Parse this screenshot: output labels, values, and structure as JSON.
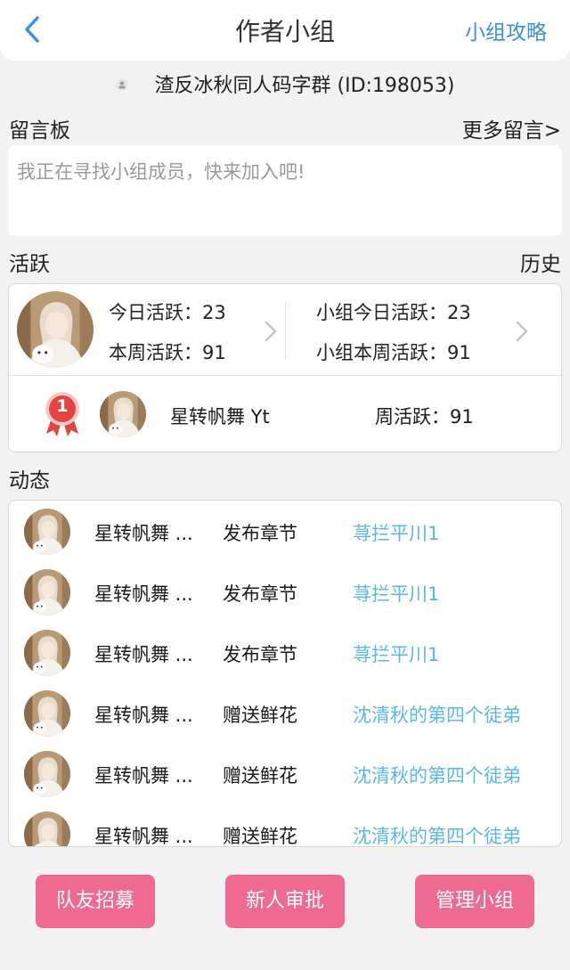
{
  "nav": {
    "title": "作者小组",
    "right_link": "小组攻略"
  },
  "group": {
    "name_line": "渣反冰秋同人码字群 (ID:198053)"
  },
  "message_board": {
    "label": "留言板",
    "more_link": "更多留言>",
    "placeholder": "我正在寻找小组成员，快来加入吧!"
  },
  "activity": {
    "label": "活跃",
    "history_link": "历史",
    "today_label": "今日活跃：",
    "today_value": "23",
    "week_label": "本周活跃：",
    "week_value": "91",
    "group_today_label": "小组今日活跃：",
    "group_today_value": "23",
    "group_week_label": "小组本周活跃：",
    "group_week_value": "91",
    "ranking": {
      "rank": "1",
      "name": "星转帆舞 Yt",
      "weekly_label": "周活跃：",
      "weekly_value": "91"
    }
  },
  "feed": {
    "label": "动态",
    "items": [
      {
        "user": "星转帆舞 ...",
        "action": "发布章节",
        "target": "荨拦平川1"
      },
      {
        "user": "星转帆舞 ...",
        "action": "发布章节",
        "target": "荨拦平川1"
      },
      {
        "user": "星转帆舞 ...",
        "action": "发布章节",
        "target": "荨拦平川1"
      },
      {
        "user": "星转帆舞 ...",
        "action": "赠送鲜花",
        "target": "沈清秋的第四个徒弟"
      },
      {
        "user": "星转帆舞 ...",
        "action": "赠送鲜花",
        "target": "沈清秋的第四个徒弟"
      },
      {
        "user": "星转帆舞 ...",
        "action": "赠送鲜花",
        "target": "沈清秋的第四个徒弟"
      }
    ]
  },
  "buttons": {
    "recruit": "队友招募",
    "approve": "新人审批",
    "manage": "管理小组"
  },
  "colors": {
    "accent_blue": "#3a8ee6",
    "link_cyan": "#5ab8e6",
    "button_pink": "#ee6a90",
    "rank_red": "#e3443f"
  }
}
